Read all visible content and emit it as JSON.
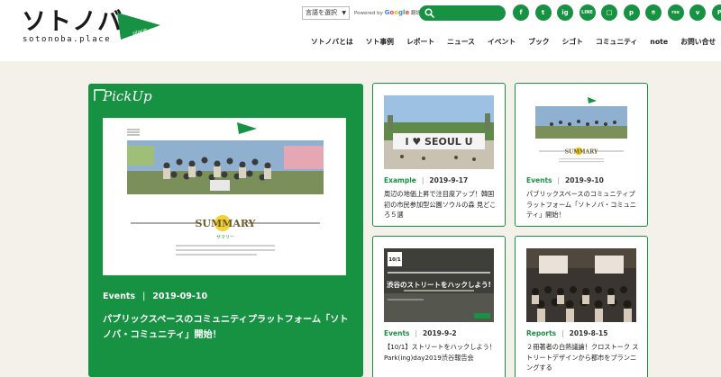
{
  "header": {
    "logo_main": "ソトノバ",
    "logo_sub": "sotonoba.place",
    "logo_flag": "place",
    "lang_select": "言語を選択",
    "powered_by": "Powered by",
    "google_letters": [
      "G",
      "o",
      "o",
      "g",
      "l",
      "e"
    ],
    "translate": "翻訳",
    "search_placeholder": "",
    "socials": [
      "f",
      "t",
      "ig",
      "LINE",
      "□",
      "p",
      "⌾",
      "rss",
      "v",
      "P"
    ],
    "nav": [
      "ソトノバとは",
      "ソト事例",
      "レポート",
      "ニュース",
      "イベント",
      "ブック",
      "シゴト",
      "コミュニティ",
      "note",
      "お問い合せ"
    ]
  },
  "pickup": {
    "label": "PickUp",
    "image_caption_top": "sotonoba community",
    "image_heading": "SUMMARY",
    "image_subheading": "サマリー",
    "category": "Events",
    "separator": "|",
    "date": "2019-09-10",
    "title": "パブリックスペースのコミュニティプラットフォーム「ソトノバ・コミュニティ」開始！"
  },
  "cards": [
    {
      "category": "Example",
      "separator": "|",
      "date": "2019-9-17",
      "title": "周辺の地価上昇で注目度アップ！韓国初の市民参加型公園ソウルの森 見どころ５選",
      "image_text": "I ♥ SEOUL U"
    },
    {
      "category": "Events",
      "separator": "|",
      "date": "2019-9-10",
      "title": "パブリックスペースのコミュニティプラットフォーム「ソトノバ・コミュニティ」開始！",
      "image_text": "SUMMARY"
    },
    {
      "category": "Events",
      "separator": "|",
      "date": "2019-9-2",
      "title": "【10/1】ストリートをハックしよう！Park(ing)day2019渋谷報告会",
      "image_text": "渋谷のストリートをハックしよう!",
      "image_date": "10/1"
    },
    {
      "category": "Reports",
      "separator": "|",
      "date": "2019-8-15",
      "title": "２冊著者の白熱議論！クロストーク ストリートデザインから都市をプランニングする",
      "image_text": ""
    }
  ]
}
